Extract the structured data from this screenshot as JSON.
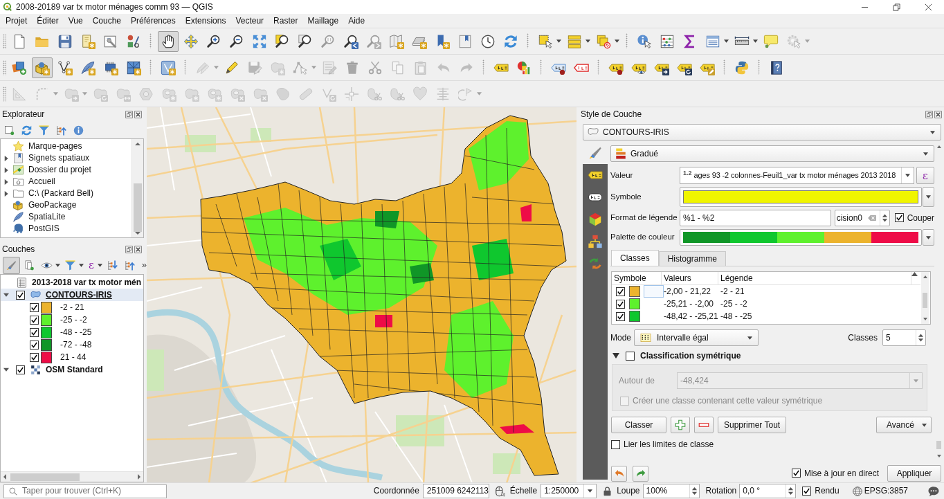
{
  "window": {
    "title": "2008-20189 var tx motor ménages comm 93 — QGIS"
  },
  "menu": [
    "Projet",
    "Éditer",
    "Vue",
    "Couche",
    "Préférences",
    "Extensions",
    "Vecteur",
    "Raster",
    "Maillage",
    "Aide"
  ],
  "toolbars": [
    {
      "buttons": [
        {
          "disabled": false,
          "pressed": false
        },
        {
          "disabled": false,
          "pressed": false
        },
        {
          "disabled": false,
          "pressed": false
        },
        {
          "disabled": false,
          "pressed": false
        },
        {
          "disabled": false,
          "pressed": false
        },
        {
          "disabled": false,
          "pressed": false
        },
        {
          "disabled": false,
          "pressed": true
        },
        {
          "disabled": false,
          "pressed": false
        },
        {
          "disabled": false,
          "pressed": false
        },
        {
          "disabled": false,
          "pressed": false
        },
        {
          "disabled": false,
          "pressed": false
        },
        {
          "disabled": false,
          "pressed": false
        },
        {
          "disabled": false,
          "pressed": false
        },
        {
          "disabled": true,
          "pressed": false
        },
        {
          "disabled": false,
          "pressed": false
        },
        {
          "disabled": true,
          "pressed": false
        },
        {
          "disabled": false,
          "pressed": false
        },
        {
          "disabled": false,
          "pressed": false
        },
        {
          "disabled": false,
          "pressed": false
        },
        {
          "disabled": false,
          "pressed": false
        },
        {
          "disabled": false,
          "pressed": false
        },
        {
          "disabled": false,
          "pressed": false
        },
        {
          "disabled": false,
          "pressed": false
        },
        {
          "disabled": false,
          "pressed": false
        },
        {
          "disabled": false,
          "pressed": false
        },
        {
          "disabled": false,
          "pressed": false
        },
        {
          "disabled": false,
          "pressed": false
        },
        {
          "disabled": false,
          "pressed": false
        },
        {
          "disabled": false,
          "pressed": false
        },
        {
          "disabled": false,
          "pressed": false
        },
        {
          "disabled": false,
          "pressed": false
        },
        {
          "disabled": true,
          "pressed": false
        }
      ]
    },
    {
      "buttons": [
        {
          "disabled": false,
          "pressed": false
        },
        {
          "disabled": false,
          "pressed": true
        },
        {
          "disabled": false,
          "pressed": false
        },
        {
          "disabled": false,
          "pressed": false
        },
        {
          "disabled": false,
          "pressed": false
        },
        {
          "disabled": false,
          "pressed": false
        },
        {
          "disabled": false,
          "pressed": false
        },
        {
          "disabled": true,
          "pressed": false
        },
        {
          "disabled": false,
          "pressed": false
        },
        {
          "disabled": true,
          "pressed": false
        },
        {
          "disabled": true,
          "pressed": false
        },
        {
          "disabled": true,
          "pressed": false
        },
        {
          "disabled": true,
          "pressed": false
        },
        {
          "disabled": true,
          "pressed": false
        },
        {
          "disabled": true,
          "pressed": false
        },
        {
          "disabled": true,
          "pressed": false
        },
        {
          "disabled": true,
          "pressed": false
        },
        {
          "disabled": true,
          "pressed": false
        },
        {
          "disabled": true,
          "pressed": false
        },
        {
          "disabled": false,
          "pressed": false
        },
        {
          "disabled": false,
          "pressed": false
        },
        {
          "disabled": false,
          "pressed": false
        },
        {
          "disabled": false,
          "pressed": false
        },
        {
          "disabled": false,
          "pressed": false
        },
        {
          "disabled": false,
          "pressed": false
        },
        {
          "disabled": false,
          "pressed": false
        },
        {
          "disabled": false,
          "pressed": false
        },
        {
          "disabled": false,
          "pressed": false
        },
        {
          "disabled": false,
          "pressed": false
        },
        {
          "disabled": false,
          "pressed": false
        }
      ]
    },
    {
      "buttons": [
        {
          "disabled": true,
          "pressed": false
        },
        {
          "disabled": true,
          "pressed": false
        },
        {
          "disabled": true,
          "pressed": false
        },
        {
          "disabled": true,
          "pressed": false
        },
        {
          "disabled": true,
          "pressed": false
        },
        {
          "disabled": true,
          "pressed": false
        },
        {
          "disabled": true,
          "pressed": false
        },
        {
          "disabled": true,
          "pressed": false
        },
        {
          "disabled": true,
          "pressed": false
        },
        {
          "disabled": true,
          "pressed": false
        },
        {
          "disabled": true,
          "pressed": false
        },
        {
          "disabled": true,
          "pressed": false
        },
        {
          "disabled": true,
          "pressed": false
        },
        {
          "disabled": true,
          "pressed": false
        },
        {
          "disabled": true,
          "pressed": false
        },
        {
          "disabled": true,
          "pressed": false
        },
        {
          "disabled": true,
          "pressed": false
        },
        {
          "disabled": true,
          "pressed": false
        },
        {
          "disabled": true,
          "pressed": false
        },
        {
          "disabled": true,
          "pressed": false
        }
      ]
    }
  ],
  "browser_panel": {
    "title": "Explorateur",
    "items": [
      {
        "label": "Marque-pages",
        "expandable": false
      },
      {
        "label": "Signets spatiaux",
        "expandable": true
      },
      {
        "label": "Dossier du projet",
        "expandable": true
      },
      {
        "label": "Accueil",
        "expandable": true
      },
      {
        "label": "C:\\ (Packard Bell)",
        "expandable": true
      },
      {
        "label": "GeoPackage",
        "expandable": false
      },
      {
        "label": "SpatiaLite",
        "expandable": false
      },
      {
        "label": "PostGIS",
        "expandable": false
      }
    ]
  },
  "layers_panel": {
    "title": "Couches",
    "toolbar": [
      {
        "pressed": true
      },
      {
        "pressed": false
      },
      {
        "pressed": false
      },
      {
        "pressed": false
      },
      {
        "pressed": false,
        "label": "ε"
      },
      {
        "pressed": false
      },
      {
        "pressed": false
      },
      {
        "pressed": false,
        "label": "»"
      }
    ],
    "layers": [
      {
        "kind": "table",
        "label": "2013-2018 var tx motor mén",
        "selected": false
      },
      {
        "kind": "vector",
        "label": "CONTOURS-IRIS",
        "checked": true,
        "expanded": true,
        "selected": true,
        "children": [
          {
            "label": "-2 - 21",
            "color": "#ecb32d",
            "checked": true
          },
          {
            "label": "-25 - -2",
            "color": "#5ef12d",
            "checked": true
          },
          {
            "label": "-48 - -25",
            "color": "#0fc72e",
            "checked": true
          },
          {
            "label": "-72 - -48",
            "color": "#109627",
            "checked": true
          },
          {
            "label": "21 - 44",
            "color": "#ee0c47",
            "checked": true
          }
        ]
      },
      {
        "kind": "raster",
        "label": "OSM Standard",
        "checked": true,
        "expanded": true,
        "selected": false
      }
    ]
  },
  "style_panel": {
    "title": "Style de Couche",
    "layer": "CONTOURS-IRIS",
    "side_tabs": [
      {
        "selected": true
      },
      {
        "selected": false
      },
      {
        "selected": false
      },
      {
        "selected": false
      },
      {
        "selected": false
      },
      {
        "selected": false
      }
    ],
    "renderer": "Gradué",
    "value_field": {
      "label": "Valeur",
      "type_badge": "1.2",
      "value": "ages 93 -2 colonnes-Feuil1_var tx motor ménages 2013 2018",
      "expression_button": "ε"
    },
    "symbol": {
      "label": "Symbole",
      "color": "#f0f500"
    },
    "legend_format": {
      "label": "Format de légende",
      "value": "%1 - %2",
      "precision": "cision0",
      "trim": {
        "label": "Couper",
        "checked": true
      }
    },
    "color_ramp": {
      "label": "Palette de couleur",
      "stops": [
        {
          "color": "#109627"
        },
        {
          "color": "#0fc72e"
        },
        {
          "color": "#5ef12d"
        },
        {
          "color": "#ecb32d"
        },
        {
          "color": "#ee0c47"
        }
      ]
    },
    "tabs": [
      {
        "label": "Classes",
        "selected": true
      },
      {
        "label": "Histogramme",
        "selected": false
      }
    ],
    "classes_table": {
      "columns": [
        "Symbole",
        "Valeurs",
        "Légende"
      ],
      "rows": [
        {
          "checked": true,
          "color": "#ecb32d",
          "focused": true,
          "values": "-2,00 - 21,22",
          "legend": "-2 - 21"
        },
        {
          "checked": true,
          "color": "#5ef12d",
          "focused": false,
          "values": "-25,21 - -2,00",
          "legend": "-25 - -2"
        },
        {
          "checked": true,
          "color": "#0fc72e",
          "focused": false,
          "values": "-48,42 - -25,21",
          "legend": "-48 - -25"
        }
      ]
    },
    "mode": {
      "label": "Mode",
      "value": "Intervalle égal"
    },
    "class_count": {
      "label": "Classes",
      "value": "5"
    },
    "symmetric": {
      "label": "Classification symétrique",
      "expanded": true,
      "checked": false,
      "disabled": true,
      "around_label": "Autour de",
      "around_value": "-48,424",
      "create_class": {
        "label": "Créer une classe contenant cette valeur symétrique",
        "checked": false
      }
    },
    "buttons": {
      "classify": "Classer",
      "delete_all": "Supprimer Tout",
      "advanced": "Avancé"
    },
    "link_bounds": {
      "label": "Lier les limites de classe",
      "checked": false
    },
    "live_update": {
      "label": "Mise à jour en direct",
      "checked": true
    },
    "apply": "Appliquer"
  },
  "status_bar": {
    "search": {
      "placeholder": "Taper pour trouver (Ctrl+K)"
    },
    "coordinate": {
      "label": "Coordonnée",
      "value": "251009 6242113"
    },
    "scale": {
      "label": "Échelle",
      "value": "1:250000"
    },
    "magnifier": {
      "label": "Loupe",
      "value": "100%"
    },
    "rotation": {
      "label": "Rotation",
      "value": "0,0 °"
    },
    "render": {
      "label": "Rendu",
      "checked": true
    },
    "crs": "EPSG:3857"
  }
}
